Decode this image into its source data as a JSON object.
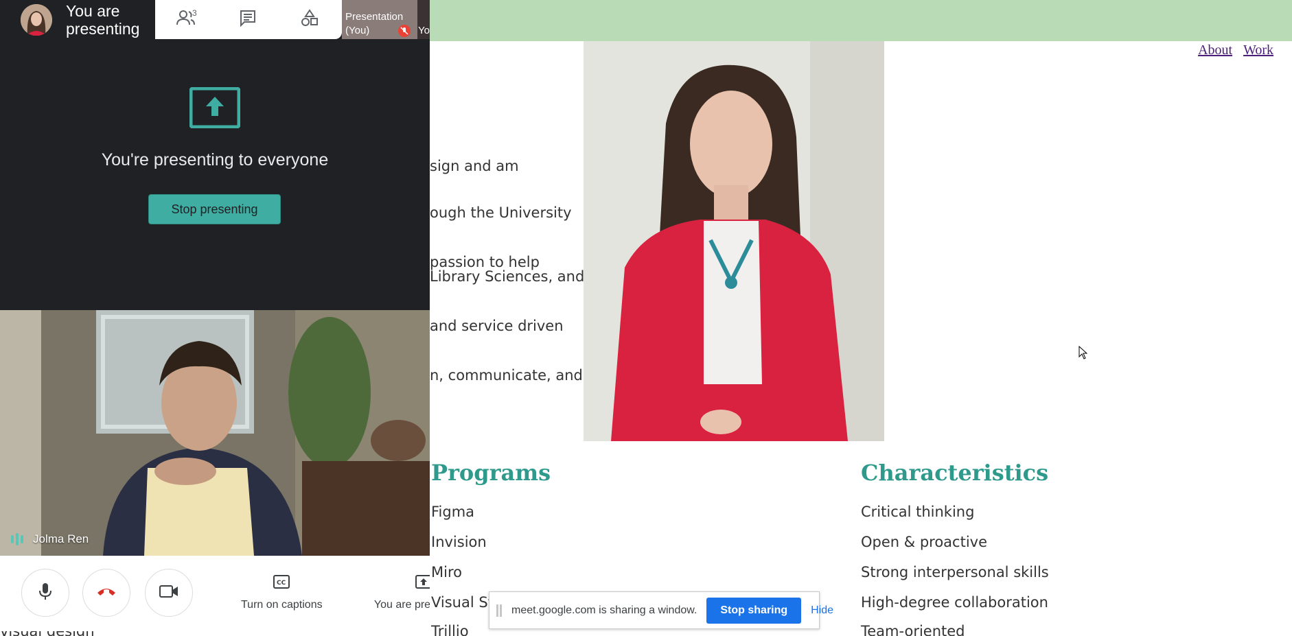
{
  "site": {
    "nav": [
      "About",
      "Work"
    ],
    "paragraphs": [
      [
        "sign and am"
      ],
      [
        "ough the University",
        "passion to help"
      ],
      [
        "Library Sciences, and",
        "and service driven",
        "n, communicate, and"
      ]
    ],
    "programs": {
      "heading": "Programs",
      "items": [
        "Figma",
        "Invision",
        "Miro",
        "Visual St",
        "Trillio"
      ],
      "left_partial": "visual design"
    },
    "characteristics": {
      "heading": "Characteristics",
      "items": [
        "Critical thinking",
        "Open & proactive",
        "Strong interpersonal skills",
        "High-degree collaboration",
        "Team-oriented"
      ]
    }
  },
  "meet": {
    "presenter_status": "You are presenting",
    "participants_count": "3",
    "thumbnail_label": "Presentation (You)",
    "thumbnail_partial": "Yo",
    "present_title": "You're presenting to everyone",
    "stop_presenting": "Stop presenting",
    "participant_name": "Jolma Ren",
    "captions_label": "Turn on captions",
    "presenting_label": "You are pre",
    "accent": "#3fada2",
    "icons": [
      "people-icon",
      "chat-icon",
      "activities-icon",
      "mic-icon",
      "hangup-icon",
      "camera-icon",
      "captions-icon",
      "present-icon"
    ]
  },
  "share_bar": {
    "text": "meet.google.com is sharing a window.",
    "stop": "Stop sharing",
    "hide": "Hide"
  }
}
